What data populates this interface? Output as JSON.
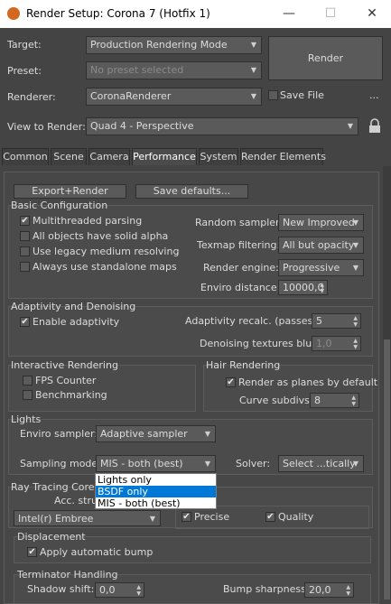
{
  "window": {
    "title": "Render Setup: Corona 7 (Hotfix 1)",
    "minimize": "—",
    "maximize": "☐",
    "close": "✕"
  },
  "top": {
    "target_label": "Target:",
    "target_value": "Production Rendering Mode",
    "preset_label": "Preset:",
    "preset_placeholder": "No preset selected",
    "renderer_label": "Renderer:",
    "renderer_value": "CoronaRenderer",
    "save_file_label": "Save File",
    "more": "...",
    "view_label": "View to Render:",
    "view_value": "Quad 4 - Perspective",
    "render_button": "Render"
  },
  "tabs": [
    "Common",
    "Scene",
    "Camera",
    "Performance",
    "System",
    "Render Elements"
  ],
  "active_tab": "Performance",
  "buttons": {
    "export_render": "Export+Render",
    "save_defaults": "Save defaults..."
  },
  "basic": {
    "title": "Basic Configuration",
    "multithreaded": "Multithreaded parsing",
    "solid_alpha": "All objects have solid alpha",
    "legacy": "Use legacy medium resolving",
    "standalone": "Always use standalone maps",
    "random_sampler_label": "Random sampler:",
    "random_sampler_value": "New Improved",
    "texmap_label": "Texmap filtering:",
    "texmap_value": "All but opacity",
    "engine_label": "Render engine:",
    "engine_value": "Progressive",
    "enviro_label": "Enviro distance:",
    "enviro_value": "10000,0"
  },
  "adaptivity": {
    "title": "Adaptivity and Denoising",
    "enable": "Enable adaptivity",
    "recalc_label": "Adaptivity recalc. (passes):",
    "recalc_value": "5",
    "blur_label": "Denoising textures blur:",
    "blur_value": "1,0"
  },
  "interactive": {
    "title": "Interactive Rendering",
    "fps": "FPS Counter",
    "bench": "Benchmarking"
  },
  "hair": {
    "title": "Hair Rendering",
    "planes": "Render as planes by default",
    "subdivs_label": "Curve subdivs:",
    "subdivs_value": "8"
  },
  "lights": {
    "title": "Lights",
    "enviro_sampler_label": "Enviro sampler:",
    "enviro_sampler_value": "Adaptive sampler",
    "sampling_label": "Sampling mode:",
    "sampling_value": "MIS - both (best)",
    "solver_label": "Solver:",
    "solver_value": "Select ...tically"
  },
  "dropdown_options": [
    "Lights only",
    "BSDF only",
    "MIS - both (best)"
  ],
  "dropdown_highlight": "BSDF only",
  "raytracing": {
    "title": "Ray Tracing Core",
    "accel_label": "Acc. stru",
    "accel_value": "Intel(r) Embree",
    "precise": "Precise",
    "quality": "Quality"
  },
  "displacement": {
    "title": "Displacement",
    "bump": "Apply automatic bump"
  },
  "terminator": {
    "title": "Terminator Handling",
    "shadow_label": "Shadow shift:",
    "shadow_value": "0,0",
    "bump_label": "Bump sharpness:",
    "bump_value": "20,0"
  },
  "check": "✔",
  "arrow": "▼",
  "spinner": "▲▼",
  "icons": {
    "app": "corona-app-icon",
    "lock": "lock-icon"
  },
  "colors": {
    "panel": "#444444",
    "group": "#4b4b4b",
    "control": "#5a5a5a",
    "highlight": "#0078d7"
  }
}
